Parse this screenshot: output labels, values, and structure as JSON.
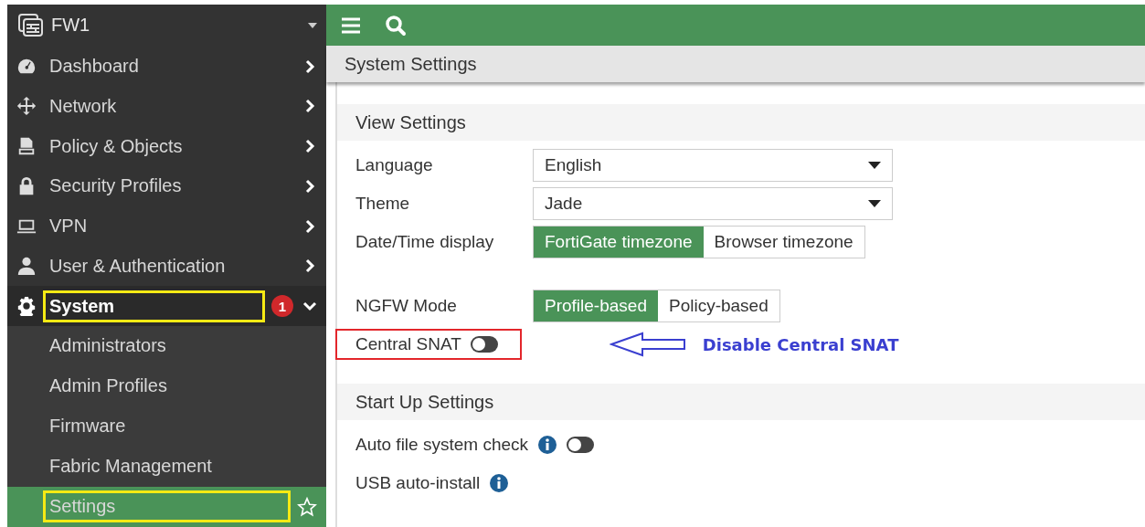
{
  "sidebar": {
    "device": "FW1",
    "items": [
      {
        "label": "Dashboard",
        "expanded": false
      },
      {
        "label": "Network",
        "expanded": false
      },
      {
        "label": "Policy & Objects",
        "expanded": false
      },
      {
        "label": "Security Profiles",
        "expanded": false
      },
      {
        "label": "VPN",
        "expanded": false
      },
      {
        "label": "User & Authentication",
        "expanded": false
      },
      {
        "label": "System",
        "expanded": true,
        "highlighted": true,
        "badge": "1",
        "children": [
          {
            "label": "Administrators",
            "selected": false,
            "highlighted": false
          },
          {
            "label": "Admin Profiles",
            "selected": false,
            "highlighted": false
          },
          {
            "label": "Firmware",
            "selected": false,
            "highlighted": false
          },
          {
            "label": "Fabric Management",
            "selected": false,
            "highlighted": false
          },
          {
            "label": "Settings",
            "selected": true,
            "highlighted": true
          }
        ]
      }
    ]
  },
  "page_title": "System Settings",
  "sections": [
    {
      "title": "View Settings",
      "groups": [
        [
          {
            "kind": "select",
            "label": "Language",
            "value": "English"
          },
          {
            "kind": "select",
            "label": "Theme",
            "value": "Jade"
          },
          {
            "kind": "segmented",
            "label": "Date/Time display",
            "options": [
              {
                "label": "FortiGate timezone",
                "selected": true
              },
              {
                "label": "Browser timezone",
                "selected": false
              }
            ]
          }
        ],
        [
          {
            "kind": "segmented",
            "label": "NGFW Mode",
            "options": [
              {
                "label": "Profile-based",
                "selected": true
              },
              {
                "label": "Policy-based",
                "selected": false
              }
            ]
          },
          {
            "kind": "toggle",
            "label": "Central SNAT",
            "on": false,
            "highlighted": true,
            "note": "Disable Central SNAT"
          }
        ]
      ]
    },
    {
      "title": "Start Up Settings",
      "groups": [
        [
          {
            "kind": "toggle",
            "label": "Auto file system check",
            "on": false,
            "info": true
          },
          {
            "kind": "label",
            "label": "USB auto-install",
            "info": true
          }
        ]
      ]
    }
  ]
}
